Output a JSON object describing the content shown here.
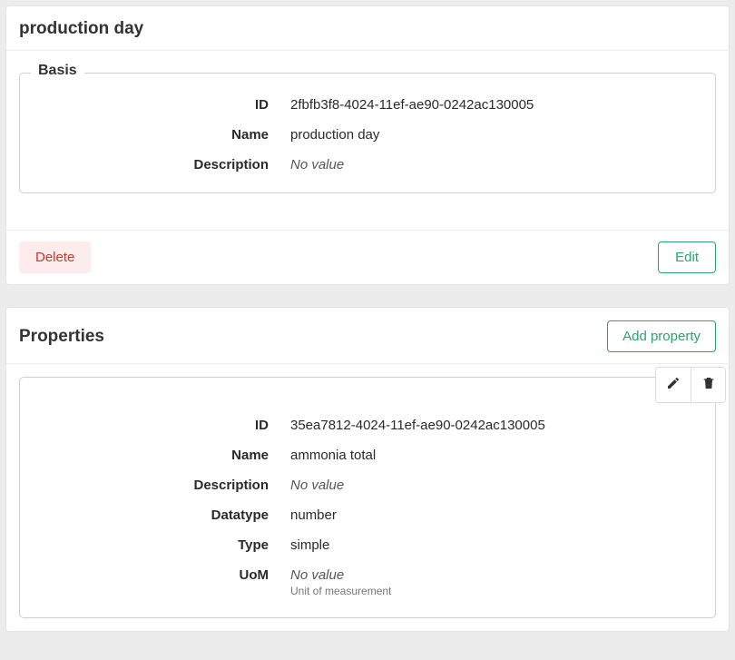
{
  "main": {
    "title": "production day",
    "basis": {
      "legend": "Basis",
      "rows": {
        "id": {
          "label": "ID",
          "value": "2fbfb3f8-4024-11ef-ae90-0242ac130005"
        },
        "name": {
          "label": "Name",
          "value": "production day"
        },
        "desc": {
          "label": "Description",
          "empty": "No value"
        }
      }
    },
    "footer": {
      "delete": "Delete",
      "edit": "Edit"
    }
  },
  "properties": {
    "title": "Properties",
    "add_label": "Add property",
    "item": {
      "rows": {
        "id": {
          "label": "ID",
          "value": "35ea7812-4024-11ef-ae90-0242ac130005"
        },
        "name": {
          "label": "Name",
          "value": "ammonia total"
        },
        "desc": {
          "label": "Description",
          "empty": "No value"
        },
        "datatype": {
          "label": "Datatype",
          "value": "number"
        },
        "type": {
          "label": "Type",
          "value": "simple"
        },
        "uom": {
          "label": "UoM",
          "empty": "No value",
          "sub": "Unit of measurement"
        }
      }
    }
  }
}
